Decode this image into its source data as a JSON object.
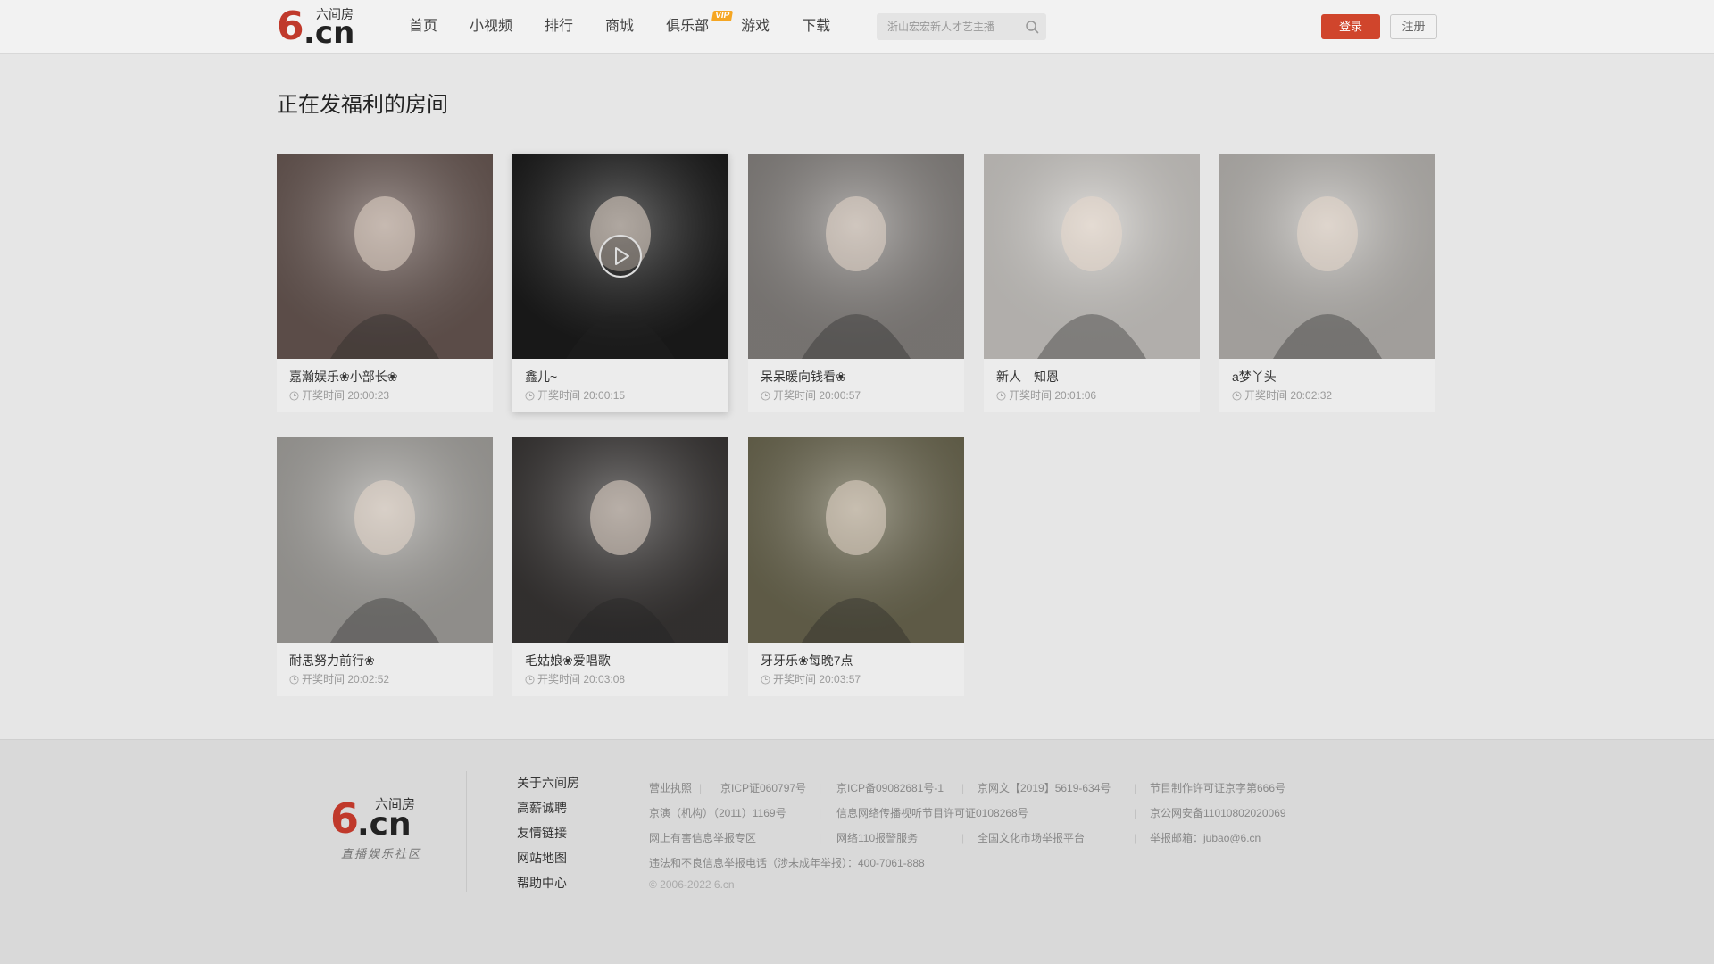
{
  "header": {
    "logo": {
      "cn_name": "六间房",
      "six": "6",
      "dotcn": ".cn"
    },
    "nav": [
      "首页",
      "小视频",
      "排行",
      "商城",
      "俱乐部",
      "游戏",
      "下载"
    ],
    "vip_badge": "VIP",
    "search_placeholder": "浙山宏宏新人才艺主播",
    "login_label": "登录",
    "register_label": "注册"
  },
  "main": {
    "title": "正在发福利的房间",
    "rooms": [
      {
        "name": "嘉瀚娱乐❀小部长❀",
        "time": "开奖时间 20:00:23",
        "bg": "#6b5a55"
      },
      {
        "name": "鑫儿~",
        "time": "开奖时间 20:00:15",
        "bg": "#1c1c1c"
      },
      {
        "name": "呆呆暖向钱看❀",
        "time": "开奖时间 20:00:57",
        "bg": "#8a8683"
      },
      {
        "name": "新人—知恩",
        "time": "开奖时间 20:01:06",
        "bg": "#d0cdc9"
      },
      {
        "name": "a梦丫头",
        "time": "开奖时间 20:02:32",
        "bg": "#bdbab6"
      },
      {
        "name": "耐思努力前行❀",
        "time": "开奖时间 20:02:52",
        "bg": "#a8a6a2"
      },
      {
        "name": "毛姑娘❀爱唱歌",
        "time": "开奖时间 20:03:08",
        "bg": "#3a3736"
      },
      {
        "name": "牙牙乐❀每晚7点",
        "time": "开奖时间 20:03:57",
        "bg": "#6e6a52"
      }
    ]
  },
  "footer": {
    "logo": {
      "cn_name": "六间房",
      "six": "6",
      "dotcn": ".cn",
      "slogan": "直播娱乐社区"
    },
    "links": [
      "关于六间房",
      "高薪诚聘",
      "友情链接",
      "网站地图",
      "帮助中心"
    ],
    "info": {
      "row1": [
        "营业执照",
        "京ICP证060797号",
        "京ICP备09082681号-1",
        "京网文【2019】5619-634号",
        "节目制作许可证京字第666号"
      ],
      "row2": [
        "京演（机构）（2011）1169号",
        "信息网络传播视听节目许可证0108268号",
        "京公网安备11010802020069"
      ],
      "row3": [
        "网上有害信息举报专区",
        "网络110报警服务",
        "全国文化市场举报平台",
        "举报邮箱：jubao@6.cn"
      ],
      "row4": "违法和不良信息举报电话（涉未成年举报）：400-7061-888",
      "copyright": "© 2006-2022 6.cn"
    }
  }
}
